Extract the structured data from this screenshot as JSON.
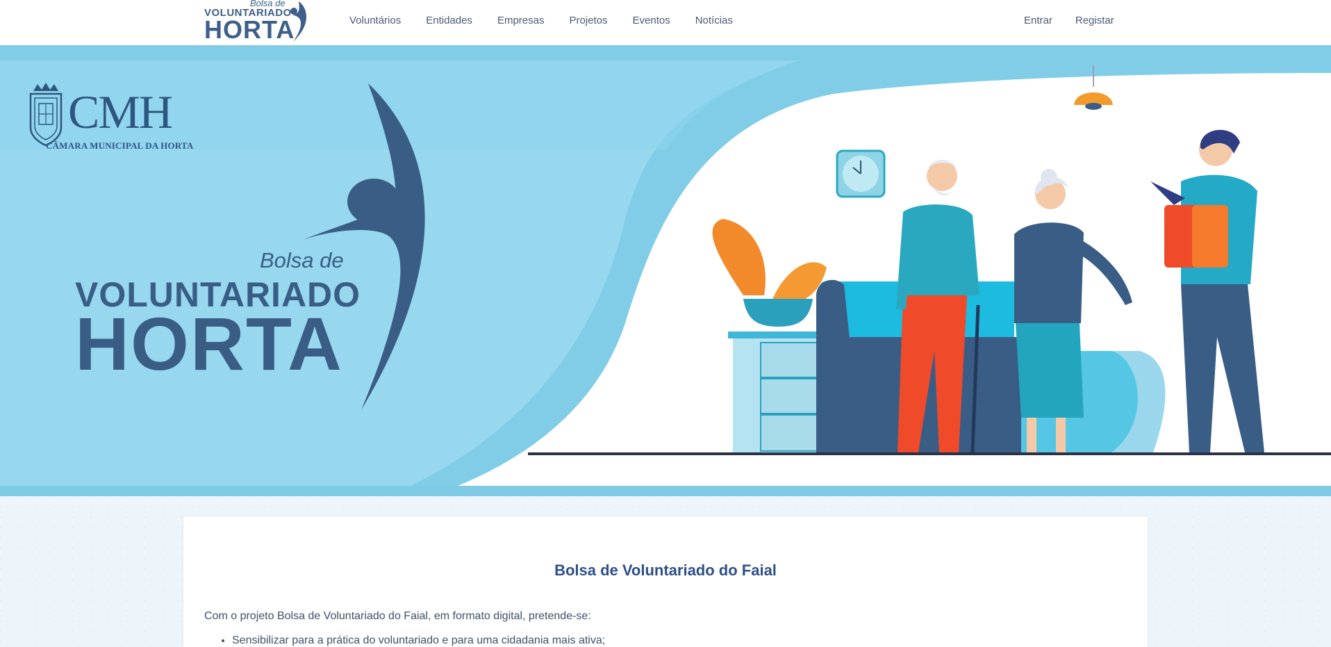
{
  "header": {
    "logo": {
      "line1": "Bolsa de",
      "line2": "VOLUNTARIADO",
      "line3": "HORTA"
    },
    "nav": [
      {
        "label": "Voluntários"
      },
      {
        "label": "Entidades"
      },
      {
        "label": "Empresas"
      },
      {
        "label": "Projetos"
      },
      {
        "label": "Eventos"
      },
      {
        "label": "Notícias"
      }
    ],
    "auth": {
      "login": "Entrar",
      "register": "Registar"
    }
  },
  "hero": {
    "cmh_logo": {
      "letters": "CMH",
      "subtitle": "CÂMARA MUNICIPAL DA HORTA"
    },
    "big_logo": {
      "line1": "Bolsa de",
      "line2": "VOLUNTARIADO",
      "line3": "HORTA"
    },
    "illustration": "volunteer-delivering-groceries-to-elderly-couple"
  },
  "content": {
    "title": "Bolsa de Voluntariado do Faial",
    "intro": "Com o projeto Bolsa de Voluntariado do Faial, em formato digital, pretende-se:",
    "bullets": [
      "Sensibilizar para a prática do voluntariado e para uma cidadania mais ativa;"
    ]
  },
  "colors": {
    "brand_dark": "#3a5d86",
    "hero_light": "#96d8ef",
    "hero_mid": "#81cde8",
    "title_blue": "#2e4f86"
  }
}
